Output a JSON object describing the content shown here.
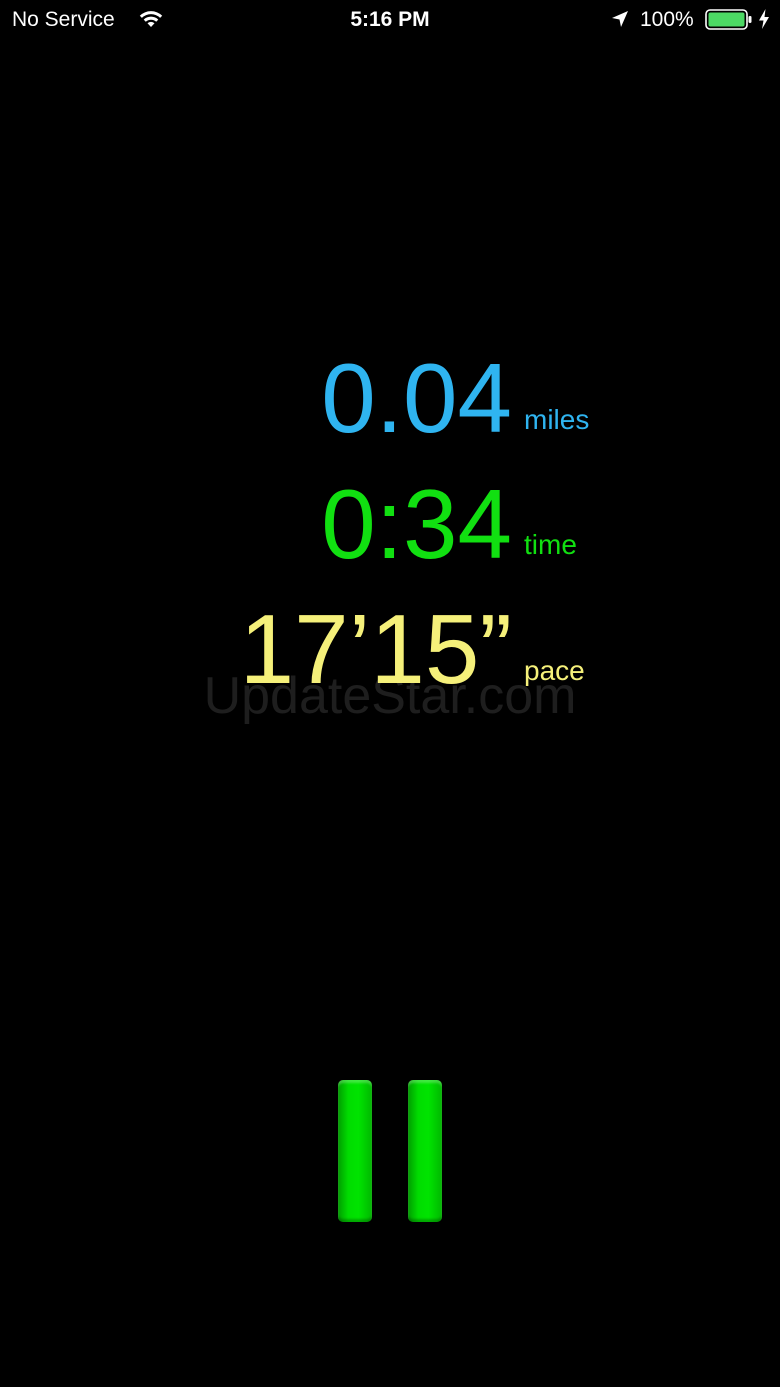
{
  "status_bar": {
    "carrier": "No Service",
    "time": "5:16 PM",
    "battery_percent": "100%",
    "icons": [
      "wifi-icon",
      "location-arrow-icon",
      "battery-icon",
      "charging-bolt-icon"
    ]
  },
  "metrics": {
    "distance": {
      "value": "0.04",
      "unit": "miles",
      "color": "#2fb4f0"
    },
    "time": {
      "value": "0:34",
      "unit": "time",
      "color": "#11e011"
    },
    "pace": {
      "value": "17’15”",
      "unit": "pace",
      "color": "#f5f07a"
    }
  },
  "watermark": "UpdateStar.com",
  "controls": {
    "pause_icon": "pause-icon",
    "accent_color": "#00d400"
  }
}
